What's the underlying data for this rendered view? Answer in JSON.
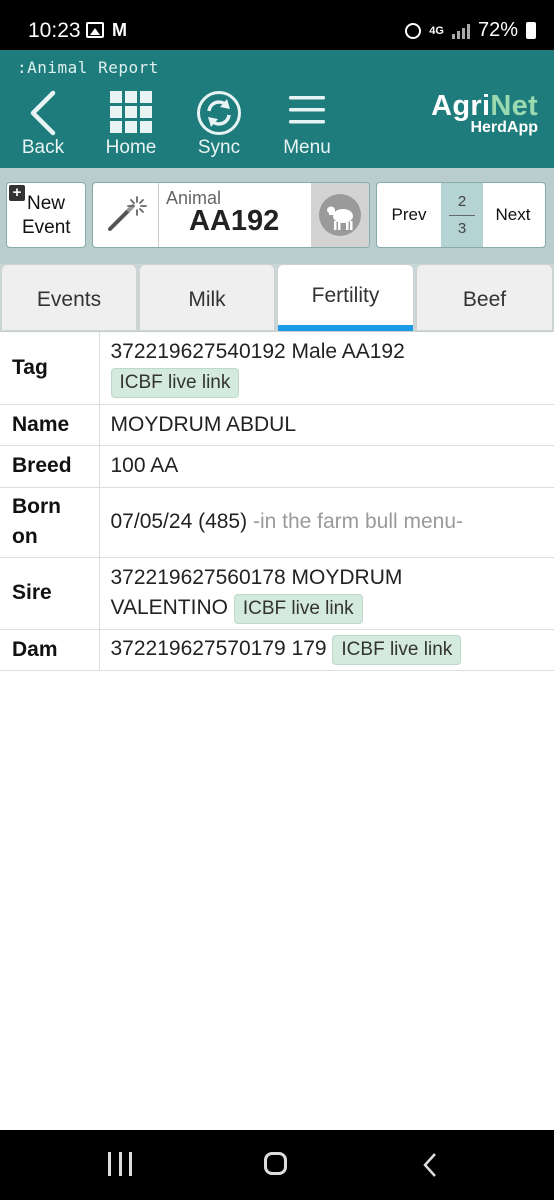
{
  "status_bar": {
    "time": "10:23",
    "network": "4G",
    "battery": "72%"
  },
  "header": {
    "screen_title": ":Animal Report",
    "nav": {
      "back": "Back",
      "home": "Home",
      "sync": "Sync",
      "menu": "Menu"
    },
    "logo": {
      "agri": "Agri",
      "net": "Net",
      "sub": "HerdApp"
    },
    "colors": {
      "header_bg": "#1e7c7c",
      "toolbar_bg": "#b9cdcd",
      "active_tab_underline": "#1e9be6",
      "badge_bg": "#d4eadf"
    }
  },
  "toolbar": {
    "new_event_line1": "New",
    "new_event_line2": "Event",
    "animal_label": "Animal",
    "animal_value": "AA192",
    "prev": "Prev",
    "next": "Next",
    "page_current": "2",
    "page_total": "3"
  },
  "tabs": [
    {
      "label": "Events",
      "active": false
    },
    {
      "label": "Milk",
      "active": false
    },
    {
      "label": "Fertility",
      "active": true
    },
    {
      "label": "Beef",
      "active": false
    }
  ],
  "details": {
    "tag": {
      "label": "Tag",
      "value": "372219627540192 Male AA192",
      "link": "ICBF live link"
    },
    "name": {
      "label": "Name",
      "value": "MOYDRUM ABDUL"
    },
    "breed": {
      "label": "Breed",
      "value": "100 AA"
    },
    "born": {
      "label_line1": "Born",
      "label_line2": "on",
      "value": "07/05/24 (485)",
      "note": "-in the farm bull menu-"
    },
    "sire": {
      "label": "Sire",
      "value_line1": "372219627560178 MOYDRUM",
      "value_line2": "VALENTINO",
      "link": "ICBF live link"
    },
    "dam": {
      "label": "Dam",
      "value": "372219627570179 179",
      "link": "ICBF live link"
    }
  },
  "icons": {
    "back": "chevron-left-icon",
    "home": "grid-icon",
    "sync": "sync-icon",
    "menu": "hamburger-icon",
    "wand": "magic-wand-icon",
    "animal": "cow-icon"
  }
}
